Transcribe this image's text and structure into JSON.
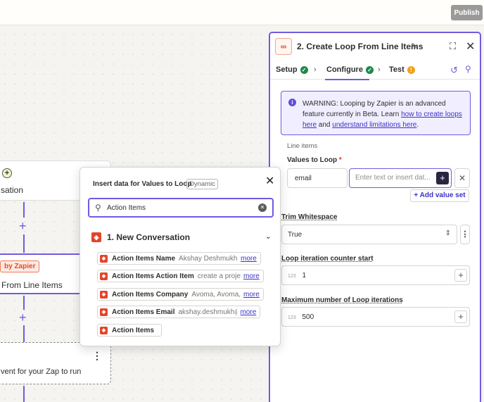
{
  "topbar": {
    "publish_label": "Publish"
  },
  "canvas": {
    "node1": {
      "title": "sation"
    },
    "node2": {
      "tag": "by Zapier",
      "title": "From Line Items"
    },
    "node3": {
      "title": "vent for your Zap to run"
    }
  },
  "panel": {
    "title": "2. Create Loop From Line Items",
    "logo": "∞",
    "tabs": [
      {
        "label": "Setup"
      },
      {
        "label": "Configure"
      },
      {
        "label": "Test"
      }
    ],
    "warning": {
      "text1": "WARNING: Looping by Zapier is an advanced feature currently in Beta. Learn ",
      "link1": "how to create loops here",
      "text2": " and ",
      "link2": "understand limitations here",
      "text3": "."
    },
    "line_items_label": "Line items",
    "values_to_loop_label": "Values to Loop",
    "required_mark": "*",
    "key_value": "email",
    "value_placeholder": "Enter text or insert dat...",
    "add_value_set_label": "Add value set",
    "trim_whitespace_label": "Trim Whitespace",
    "trim_whitespace_value": "True",
    "counter_start_label": "Loop iteration counter start",
    "counter_start_value": "1",
    "max_iterations_label": "Maximum number of Loop iterations",
    "max_iterations_value": "500",
    "num_hint": "123"
  },
  "popup": {
    "title": "Insert data for Values to Loop",
    "badge": "Dynamic",
    "search_value": "Action Items",
    "group_title": "1.  New Conversation",
    "options": [
      {
        "name": "Action Items Name",
        "sample": "Akshay Deshmukh,",
        "more": "more"
      },
      {
        "name": "Action Items Action Item",
        "sample": "create a proje",
        "more": "more"
      },
      {
        "name": "Action Items Company",
        "sample": "Avoma, Avoma,",
        "more": "more"
      },
      {
        "name": "Action Items Email",
        "sample": "akshay.deshmukh@",
        "more": "more"
      },
      {
        "name": "Action Items",
        "sample": "",
        "more": ""
      }
    ]
  },
  "colors": {
    "accent": "#6f5ce0",
    "brand_orange": "#e24f22",
    "app_red": "#e2452b",
    "success": "#1c8a4c",
    "warning": "#f2a11a"
  }
}
